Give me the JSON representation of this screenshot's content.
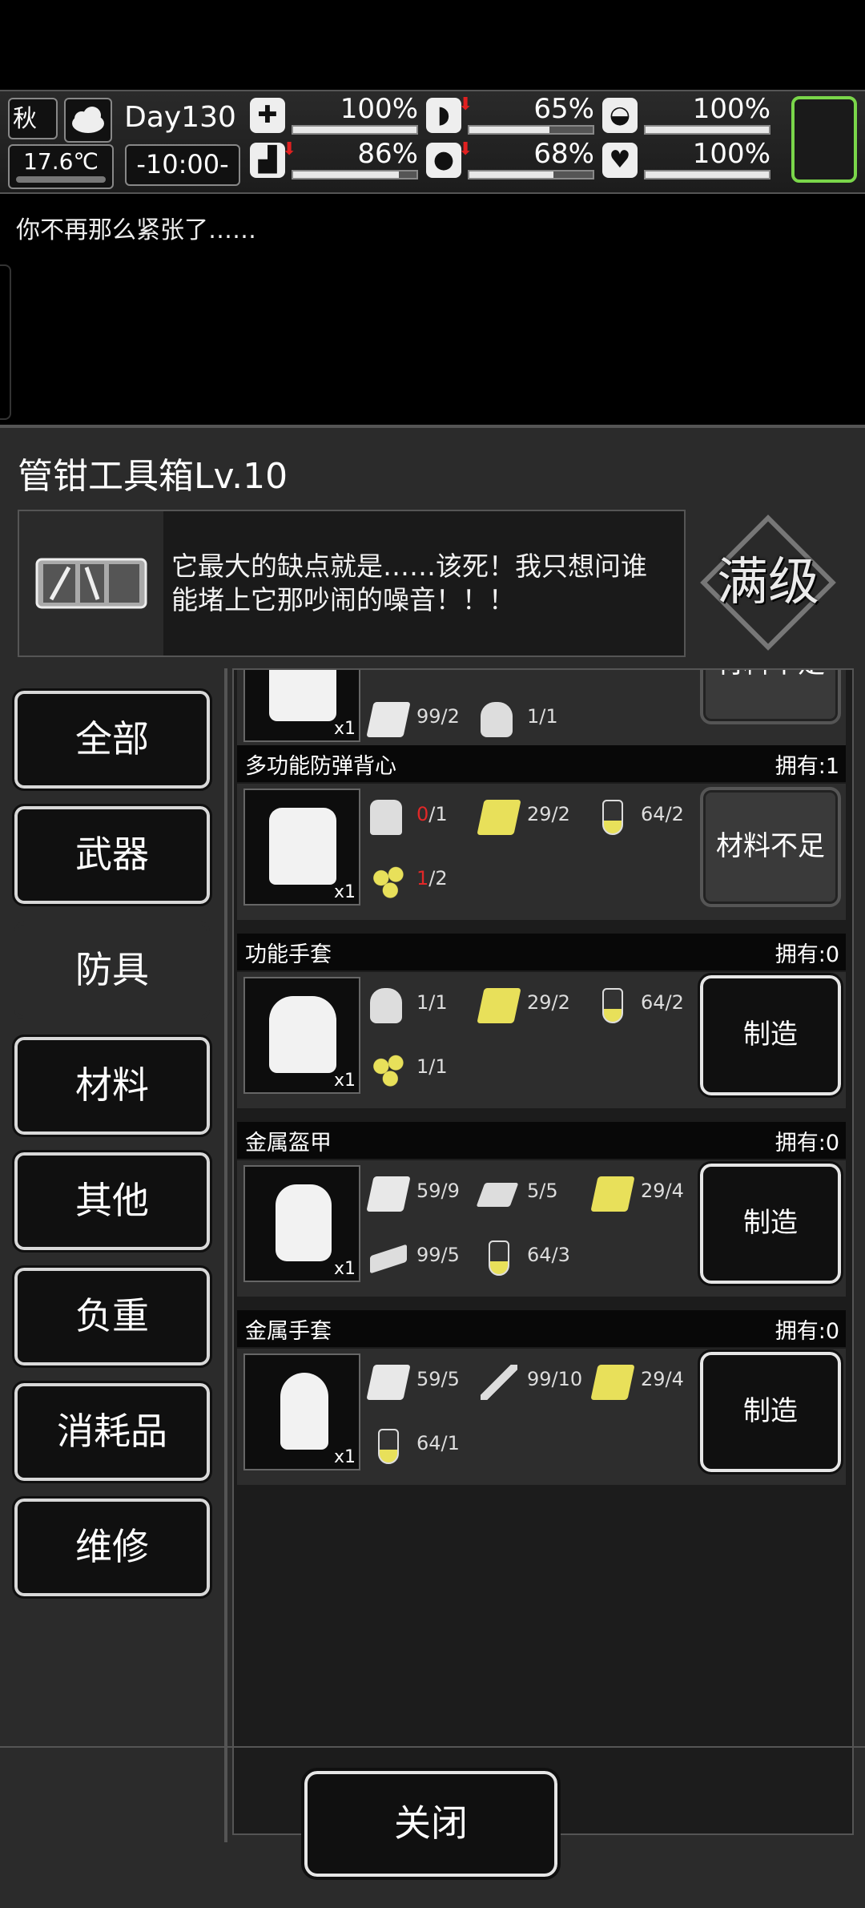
{
  "hud": {
    "season": "秋",
    "temperature": "17.6℃",
    "day": "Day130",
    "time": "-10:00-",
    "stats": [
      {
        "id": "health",
        "icon": "medkit-icon",
        "value": "100%",
        "level": 1.0,
        "down": false
      },
      {
        "id": "hunger",
        "icon": "stomach-icon",
        "value": "65%",
        "level": 0.65,
        "down": true
      },
      {
        "id": "defense",
        "icon": "shield-icon",
        "value": "100%",
        "level": 1.0,
        "down": false
      },
      {
        "id": "stamina",
        "icon": "boot-icon",
        "value": "86%",
        "level": 0.86,
        "down": true
      },
      {
        "id": "thirst",
        "icon": "water-drop-icon",
        "value": "68%",
        "level": 0.68,
        "down": true
      },
      {
        "id": "mood",
        "icon": "heart-icon",
        "value": "100%",
        "level": 1.0,
        "down": false
      }
    ]
  },
  "message": "你不再那么紧张了……",
  "panel": {
    "title": "管钳工具箱Lv.10",
    "description": "它最大的缺点就是……该死！我只想问谁能堵上它那吵闹的噪音！！！",
    "max_badge": "满级"
  },
  "categories": [
    {
      "label": "全部",
      "active": false
    },
    {
      "label": "武器",
      "active": false
    },
    {
      "label": "防具",
      "active": true
    },
    {
      "label": "材料",
      "active": false
    },
    {
      "label": "其他",
      "active": false
    },
    {
      "label": "负重",
      "active": false
    },
    {
      "label": "消耗品",
      "active": false
    },
    {
      "label": "维修",
      "active": false
    }
  ],
  "partial_recipe": {
    "x1": "x1",
    "materials": [
      {
        "icon": "cloth-icon",
        "qty": "99/2"
      },
      {
        "icon": "glove-icon",
        "qty": "1/1"
      }
    ],
    "button": "材料不足"
  },
  "recipes": [
    {
      "name": "多功能防弹背心",
      "owned": "拥有:1",
      "x1": "x1",
      "button": "材料不足",
      "enabled": false,
      "materials": [
        {
          "icon": "vest-icon",
          "have": "0",
          "need": "/1",
          "short": true
        },
        {
          "icon": "gold-cloth-icon",
          "have": "29",
          "need": "/2",
          "short": false
        },
        {
          "icon": "flask-icon",
          "have": "64",
          "need": "/2",
          "short": false
        },
        {
          "icon": "gold-nuggets-icon",
          "have": "1",
          "need": "/2",
          "short": true
        }
      ]
    },
    {
      "name": "功能手套",
      "owned": "拥有:0",
      "x1": "x1",
      "button": "制造",
      "enabled": true,
      "materials": [
        {
          "icon": "glove-icon",
          "have": "1",
          "need": "/1",
          "short": false
        },
        {
          "icon": "gold-cloth-icon",
          "have": "29",
          "need": "/2",
          "short": false
        },
        {
          "icon": "flask-icon",
          "have": "64",
          "need": "/2",
          "short": false
        },
        {
          "icon": "gold-nuggets-icon",
          "have": "1",
          "need": "/1",
          "short": false
        }
      ]
    },
    {
      "name": "金属盔甲",
      "owned": "拥有:0",
      "x1": "x1",
      "button": "制造",
      "enabled": true,
      "materials": [
        {
          "icon": "cloth-icon",
          "have": "59",
          "need": "/9",
          "short": false
        },
        {
          "icon": "metal-plate-icon",
          "have": "5",
          "need": "/5",
          "short": false
        },
        {
          "icon": "gold-cloth-icon",
          "have": "29",
          "need": "/4",
          "short": false
        },
        {
          "icon": "ingot-icon",
          "have": "99",
          "need": "/5",
          "short": false
        },
        {
          "icon": "flask-icon",
          "have": "64",
          "need": "/3",
          "short": false
        }
      ]
    },
    {
      "name": "金属手套",
      "owned": "拥有:0",
      "x1": "x1",
      "button": "制造",
      "enabled": true,
      "materials": [
        {
          "icon": "cloth-icon",
          "have": "59",
          "need": "/5",
          "short": false
        },
        {
          "icon": "screw-icon",
          "have": "99",
          "need": "/10",
          "short": false
        },
        {
          "icon": "gold-cloth-icon",
          "have": "29",
          "need": "/4",
          "short": false
        },
        {
          "icon": "flask-icon",
          "have": "64",
          "need": "/1",
          "short": false
        }
      ]
    }
  ],
  "footer": {
    "close": "关闭"
  }
}
